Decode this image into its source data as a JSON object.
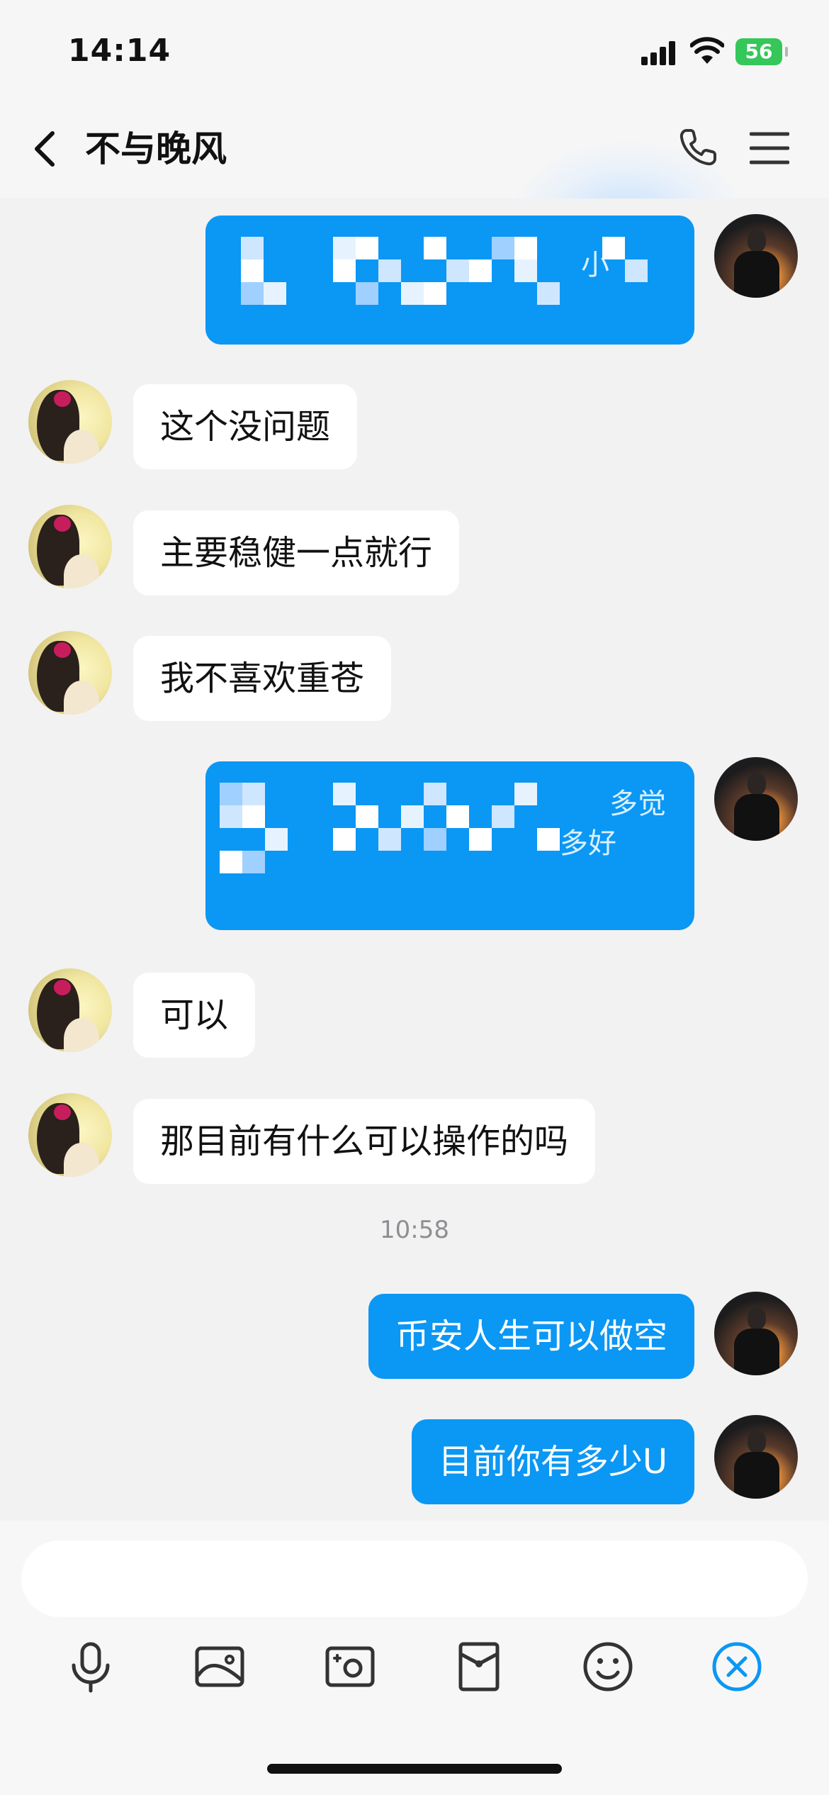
{
  "status_bar": {
    "time": "14:14",
    "battery": "56"
  },
  "header": {
    "contact_name": "不与晚风"
  },
  "messages": [
    {
      "side": "out",
      "text": "",
      "redacted": true,
      "visible_fragments": [
        "小",
        " "
      ]
    },
    {
      "side": "in",
      "text": "这个没问题"
    },
    {
      "side": "in",
      "text": "主要稳健一点就行"
    },
    {
      "side": "in",
      "text": "我不喜欢重苍"
    },
    {
      "side": "out",
      "text": "",
      "redacted": true,
      "visible_fragments": [
        "多觉",
        "多好"
      ]
    },
    {
      "side": "in",
      "text": "可以"
    },
    {
      "side": "in",
      "text": "那目前有什么可以操作的吗"
    },
    {
      "side": "out",
      "text": "币安人生可以做空"
    },
    {
      "side": "out",
      "text": "目前你有多少U"
    }
  ],
  "timestamp": "10:58",
  "input": {
    "value": "",
    "placeholder": ""
  },
  "toolbar": {
    "icons": [
      "microphone-icon",
      "image-icon",
      "camera-icon",
      "red-packet-icon",
      "emoji-icon",
      "close-icon"
    ]
  },
  "colors": {
    "accent": "#0b97f4",
    "background": "#f2f2f2",
    "bubble_in": "#ffffff",
    "battery": "#35c759"
  }
}
